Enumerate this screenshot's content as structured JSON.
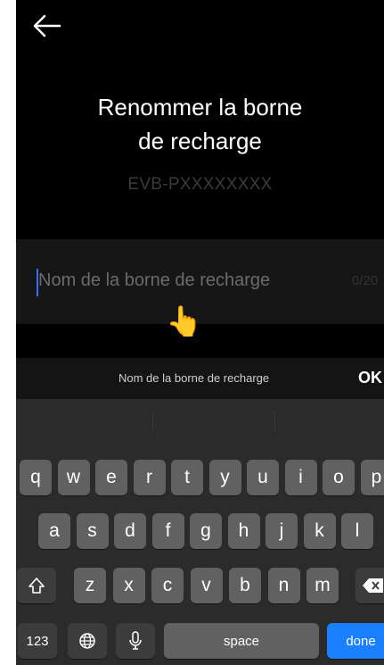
{
  "header": {
    "title_line1": "Renommer la borne",
    "title_line2": "de recharge",
    "device_id": "EVB-PXXXXXXXX"
  },
  "input": {
    "placeholder": "Nom de la borne de recharge",
    "counter": "0/20"
  },
  "keyboard_toolbar": {
    "label": "Nom de la borne de recharge",
    "ok": "OK"
  },
  "keyboard": {
    "row1": [
      "q",
      "w",
      "e",
      "r",
      "t",
      "y",
      "u",
      "i",
      "o",
      "p"
    ],
    "row2": [
      "a",
      "s",
      "d",
      "f",
      "g",
      "h",
      "j",
      "k",
      "l"
    ],
    "row3": [
      "z",
      "x",
      "c",
      "v",
      "b",
      "n",
      "m"
    ],
    "numbers": "123",
    "space": "space",
    "done": "done"
  },
  "colors": {
    "accent": "#1a80ff",
    "caret": "#3b6cff"
  }
}
